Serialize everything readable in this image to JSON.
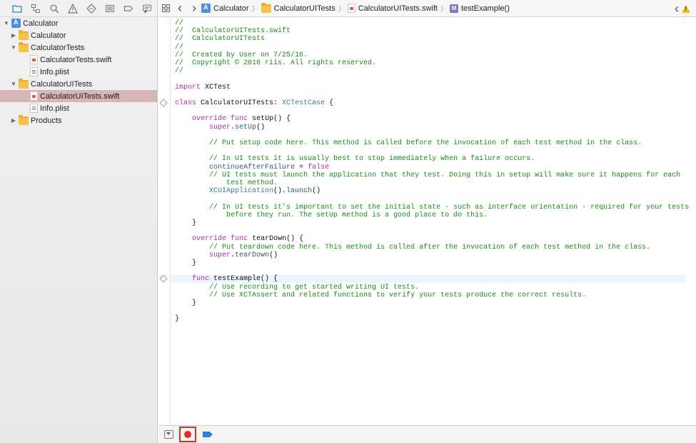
{
  "navigator": {
    "icons": [
      "folder-icon",
      "source-control-icon",
      "search-icon",
      "warning-icon",
      "test-navigator-icon",
      "debug-icon",
      "breakpoint-icon",
      "report-icon"
    ],
    "items": [
      {
        "label": "Calculator",
        "kind": "project",
        "disclosure": "▼"
      },
      {
        "label": "Calculator",
        "kind": "folder",
        "disclosure": "▶"
      },
      {
        "label": "CalculatorTests",
        "kind": "folder",
        "disclosure": "▼"
      },
      {
        "label": "CalculatorTests.swift",
        "kind": "swift",
        "disclosure": ""
      },
      {
        "label": "Info.plist",
        "kind": "plist",
        "disclosure": ""
      },
      {
        "label": "CalculatorUITests",
        "kind": "folder",
        "disclosure": "▼"
      },
      {
        "label": "CalculatorUITests.swift",
        "kind": "swift",
        "disclosure": "",
        "selected": true
      },
      {
        "label": "Info.plist",
        "kind": "plist",
        "disclosure": ""
      },
      {
        "label": "Products",
        "kind": "folder",
        "disclosure": "▶"
      }
    ]
  },
  "jumpbar": {
    "back": "‹",
    "forward": "›",
    "crumbs": [
      "Calculator",
      "CalculatorUITests",
      "CalculatorUITests.swift",
      "testExample()"
    ],
    "method_badge": "M",
    "issue_prev": "‹"
  },
  "code": {
    "lines": [
      {
        "segs": [
          [
            "cm",
            "//"
          ]
        ]
      },
      {
        "segs": [
          [
            "cm",
            "//  CalculatorUITests.swift"
          ]
        ]
      },
      {
        "segs": [
          [
            "cm",
            "//  CalculatorUITests"
          ]
        ]
      },
      {
        "segs": [
          [
            "cm",
            "//"
          ]
        ]
      },
      {
        "segs": [
          [
            "cm",
            "//  Created by User on 7/25/16."
          ]
        ]
      },
      {
        "segs": [
          [
            "cm",
            "//  Copyright © 2016 riis. All rights reserved."
          ]
        ]
      },
      {
        "segs": [
          [
            "cm",
            "//"
          ]
        ]
      },
      {
        "segs": []
      },
      {
        "segs": [
          [
            "kw",
            "import"
          ],
          [
            "tx",
            " XCTest"
          ]
        ]
      },
      {
        "segs": []
      },
      {
        "segs": [
          [
            "kw",
            "class"
          ],
          [
            "tx",
            " CalculatorUITests: "
          ],
          [
            "ty",
            "XCTestCase"
          ],
          [
            "tx",
            " {"
          ]
        ],
        "diamond": true
      },
      {
        "segs": []
      },
      {
        "segs": [
          [
            "tx",
            "    "
          ],
          [
            "kw",
            "override"
          ],
          [
            "tx",
            " "
          ],
          [
            "kw",
            "func"
          ],
          [
            "tx",
            " setUp() {"
          ]
        ]
      },
      {
        "segs": [
          [
            "tx",
            "        "
          ],
          [
            "kw",
            "super"
          ],
          [
            "tx",
            "."
          ],
          [
            "fn",
            "setUp"
          ],
          [
            "tx",
            "()"
          ]
        ]
      },
      {
        "segs": []
      },
      {
        "segs": [
          [
            "tx",
            "        "
          ],
          [
            "cm",
            "// Put setup code here. This method is called before the invocation of each test method in the class."
          ]
        ]
      },
      {
        "segs": []
      },
      {
        "segs": [
          [
            "tx",
            "        "
          ],
          [
            "cm",
            "// In UI tests it is usually best to stop immediately when a failure occurs."
          ]
        ]
      },
      {
        "segs": [
          [
            "tx",
            "        "
          ],
          [
            "fn",
            "continueAfterFailure"
          ],
          [
            "tx",
            " = "
          ],
          [
            "kw",
            "false"
          ]
        ]
      },
      {
        "segs": [
          [
            "tx",
            "        "
          ],
          [
            "cm",
            "// UI tests must launch the application that they test. Doing this in setup will make sure it happens for each"
          ]
        ]
      },
      {
        "segs": [
          [
            "tx",
            "            "
          ],
          [
            "cm",
            "test method."
          ]
        ]
      },
      {
        "segs": [
          [
            "tx",
            "        "
          ],
          [
            "ty",
            "XCUIApplication"
          ],
          [
            "tx",
            "()."
          ],
          [
            "fn",
            "launch"
          ],
          [
            "tx",
            "()"
          ]
        ]
      },
      {
        "segs": []
      },
      {
        "segs": [
          [
            "tx",
            "        "
          ],
          [
            "cm",
            "// In UI tests it's important to set the initial state - such as interface orientation - required for your tests"
          ]
        ]
      },
      {
        "segs": [
          [
            "tx",
            "            "
          ],
          [
            "cm",
            "before they run. The setUp method is a good place to do this."
          ]
        ]
      },
      {
        "segs": [
          [
            "tx",
            "    }"
          ]
        ]
      },
      {
        "segs": []
      },
      {
        "segs": [
          [
            "tx",
            "    "
          ],
          [
            "kw",
            "override"
          ],
          [
            "tx",
            " "
          ],
          [
            "kw",
            "func"
          ],
          [
            "tx",
            " tearDown() {"
          ]
        ]
      },
      {
        "segs": [
          [
            "tx",
            "        "
          ],
          [
            "cm",
            "// Put teardown code here. This method is called after the invocation of each test method in the class."
          ]
        ]
      },
      {
        "segs": [
          [
            "tx",
            "        "
          ],
          [
            "kw",
            "super"
          ],
          [
            "tx",
            "."
          ],
          [
            "fn",
            "tearDown"
          ],
          [
            "tx",
            "()"
          ]
        ]
      },
      {
        "segs": [
          [
            "tx",
            "    }"
          ]
        ]
      },
      {
        "segs": []
      },
      {
        "segs": [
          [
            "tx",
            "    "
          ],
          [
            "kw",
            "func"
          ],
          [
            "tx",
            " testExample() {"
          ]
        ],
        "diamond": true,
        "highlight": true
      },
      {
        "segs": [
          [
            "tx",
            "        "
          ],
          [
            "cm",
            "// Use recording to get started writing UI tests."
          ]
        ]
      },
      {
        "segs": [
          [
            "tx",
            "        "
          ],
          [
            "cm",
            "// Use XCTAssert and related functions to verify your tests produce the correct results."
          ]
        ]
      },
      {
        "segs": [
          [
            "tx",
            "    }"
          ]
        ]
      },
      {
        "segs": []
      },
      {
        "segs": [
          [
            "tx",
            "}"
          ]
        ]
      }
    ]
  },
  "bottombar": {
    "buttons": [
      "hide-debug-area-button",
      "record-ui-test-button",
      "breakpoints-toggle-button"
    ]
  }
}
